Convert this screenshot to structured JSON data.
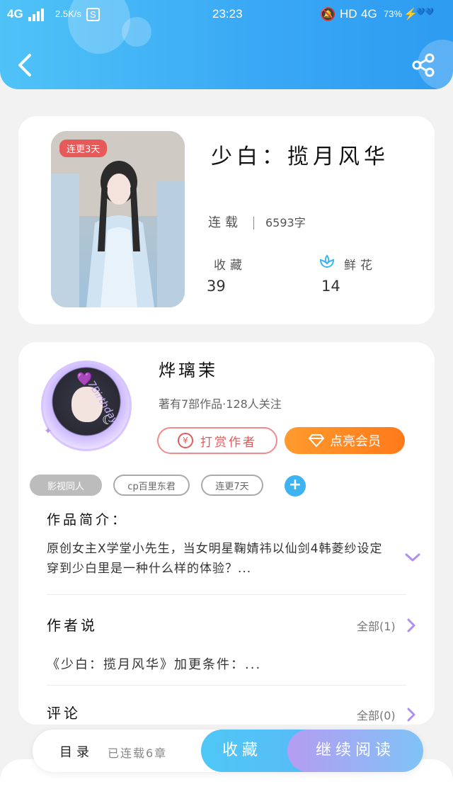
{
  "status_bar": {
    "network_left": "4G",
    "speed": "2.5K/s",
    "s_badge": "S",
    "time": "23:23",
    "hd": "HD",
    "network_right": "4G",
    "battery": "73%",
    "battery_hearts": "💙💙"
  },
  "header": {
    "back_icon": "back-arrow-icon",
    "share_icon": "share-icon"
  },
  "book": {
    "cover_tag": "连更3天",
    "title": "少白：揽月风华",
    "status": "连载",
    "word_count": "6593字",
    "favorites_label": "收藏",
    "favorites_value": "39",
    "flowers_label": "鲜花",
    "flowers_value": "14"
  },
  "author": {
    "name": "烨璃茉",
    "meta": "著有7部作品·128人关注",
    "tip_label": "打赏作者",
    "tip_coin": "¥",
    "vip_label": "点亮会员",
    "avatar_deco": "7Birthday"
  },
  "tags": [
    "影视同人",
    "cp百里东君",
    "连更7天"
  ],
  "add_tag": "+",
  "intro": {
    "heading": "作品简介：",
    "text": "原创女主X学堂小先生，当女明星鞠婧祎以仙剑4韩菱纱设定穿到少白里是一种什么样的体验？..."
  },
  "author_said": {
    "heading": "作者说",
    "all": "全部(1)",
    "text": "《少白：揽月风华》加更条件：..."
  },
  "comments": {
    "heading": "评论",
    "all": "全部(0)"
  },
  "bottom_bar": {
    "toc_label": "目录",
    "toc_count": "已连载6章",
    "collect_label": "收藏",
    "read_label": "继续阅读"
  },
  "colors": {
    "header_blue": "#3aa9f5",
    "accent_orange": "#ff8a1e",
    "tip_red": "#e25b5b",
    "cover_tag_red": "#e65a5a",
    "add_blue": "#3fb3f2",
    "expand_purple": "#b08ef0"
  }
}
